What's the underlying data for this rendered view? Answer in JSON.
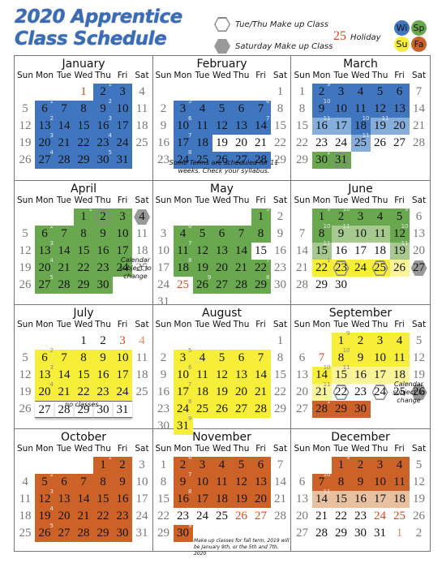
{
  "title": {
    "line1": "2020 Apprentice",
    "line2": "Class Schedule"
  },
  "legend": {
    "tue_thu": "Tue/Thu Make up Class",
    "saturday": "Saturday Make up Class",
    "holiday_num": "25",
    "holiday": "Holiday",
    "terms": [
      {
        "label": "Wi",
        "color": "#3f76bf"
      },
      {
        "label": "Sp",
        "color": "#6aa84f"
      },
      {
        "label": "Su",
        "color": "#f7ee3a"
      },
      {
        "label": "Fa",
        "color": "#cc6228"
      }
    ]
  },
  "dows": [
    "Sun",
    "Mon",
    "Tue",
    "Wed",
    "Thu",
    "Fri",
    "Sat"
  ],
  "colors": {
    "W": "#3f76bf",
    "w": "#86aedb",
    "S": "#6aa84f",
    "s": "#a6c98f",
    "U": "#f7ee3a",
    "u": "#fbf59a",
    "F": "#cc6228",
    "f": "#e8c1a0",
    "holiday": "#d44a1e"
  },
  "months": [
    {
      "name": "January",
      "weeks": [
        [
          "",
          "",
          "",
          "1:r:",
          "2:W:1",
          "3:W:",
          "4:g:"
        ],
        [
          "5:g:",
          "6:W:1",
          "7:W:",
          "8:W:",
          "9:W:2",
          "10:W:",
          "11:g:"
        ],
        [
          "12:g:",
          "13:W:2",
          "14:W:",
          "15:W:",
          "16:W:3",
          "17:W:",
          "18:g:"
        ],
        [
          "19:g:",
          "20:W:3",
          "21:W:",
          "22:W:",
          "23:W:4",
          "24:W:",
          "25:g:"
        ],
        [
          "26:g:",
          "27:W:4",
          "28:W:",
          "29:W:",
          "30:W:5",
          "31:W:",
          ""
        ]
      ]
    },
    {
      "name": "February",
      "note": "Some Terms are scheduled for 11 weeks. Check your syllabus.",
      "weeks": [
        [
          "",
          "",
          "",
          "",
          "",
          "",
          "1:g:"
        ],
        [
          "2:g:",
          "3:W:5",
          "4:W:",
          "5:W:",
          "6:W:",
          "7:W:6",
          "8:g:"
        ],
        [
          "9:g:",
          "10:W:6",
          "11:W:",
          "12:W:",
          "13:W:",
          "14:W:7",
          "15:g:"
        ],
        [
          "16:g:",
          "17:W:7",
          "18:W:",
          "19::",
          "20::",
          "21::",
          "22:g:"
        ],
        [
          "23:g:",
          "24:W:8",
          "25:W:",
          "26:W:",
          "27:W:",
          "28:W:",
          "29:g:"
        ]
      ]
    },
    {
      "name": "March",
      "weeks": [
        [
          "1:g:",
          "2:W:9",
          "3:W:",
          "4:W:",
          "5:W:",
          "6:W:",
          "7:g:"
        ],
        [
          "8:g:",
          "9:W:10",
          "10:W:",
          "11:W:",
          "12:W:",
          "13:W:",
          "14:g:"
        ],
        [
          "15:g:",
          "16:w:11",
          "17:w:",
          "18:W:10",
          "19:w:11",
          "20:w:",
          "21:g:"
        ],
        [
          "22:g:",
          "23::",
          "24::",
          "25:w:11",
          "26::",
          "27::",
          "28:g:"
        ],
        [
          "29:g:",
          "30:S:1",
          "31:Sh:",
          "",
          "",
          "",
          ""
        ]
      ]
    },
    {
      "name": "April",
      "note": "Calendar subject to change",
      "weeks": [
        [
          "",
          "",
          "",
          "1:S:1",
          "2:Sh:",
          "3:S:",
          "4:H:"
        ],
        [
          "5:g:",
          "6:S:2",
          "7:S:",
          "8:S:",
          "9:S:",
          "10:S:",
          "11:g:"
        ],
        [
          "12:g:",
          "13:S:3",
          "14:S:",
          "15:S:",
          "16:S:",
          "17:S:",
          "18:g:"
        ],
        [
          "19:g:",
          "20:S:4",
          "21:S:",
          "22:S:",
          "23:S:",
          "24:S:",
          "25:g:"
        ],
        [
          "26:g:",
          "27:S:5",
          "28:S:",
          "29:S:",
          "30:S:",
          "",
          ""
        ]
      ]
    },
    {
      "name": "May",
      "weeks": [
        [
          "",
          "",
          "",
          "",
          "",
          "1:S:5",
          "2:g:"
        ],
        [
          "3:g:",
          "4:S:6",
          "5:S:",
          "6:S:",
          "7:S:",
          "8:S:",
          "9:g:"
        ],
        [
          "10:g:",
          "11:S:7",
          "12:S:",
          "13:S:",
          "14:S:",
          "15::",
          "16:g:"
        ],
        [
          "17:g:",
          "18:S:8",
          "19:S:",
          "20:S:",
          "21:S:",
          "22:S:7",
          "23:g:"
        ],
        [
          "24:g:",
          "25:r:",
          "26:S:9",
          "27:S:",
          "28:S:",
          "29:S:8",
          "30:g:"
        ],
        [
          "31:g:",
          "",
          "",
          "",
          "",
          "",
          ""
        ]
      ]
    },
    {
      "name": "June",
      "weeks": [
        [
          "",
          "1:S:9",
          "2:S:10",
          "3:S:",
          "4:S:",
          "5:S:9",
          "6:g:"
        ],
        [
          "7:g:",
          "8:S:10",
          "9:s:11",
          "10:s:",
          "11:s:",
          "12:S:10",
          "13:g:"
        ],
        [
          "14:g:",
          "15:s:11",
          "16::",
          "17::",
          "18::",
          "19:s:11",
          "20:g:"
        ],
        [
          "21:g:",
          "22:U:1",
          "23:Uh:",
          "24:U:",
          "25:Uh:",
          "26:u:",
          "27:H:"
        ],
        [
          "28:g:",
          "29::",
          "30::",
          "",
          "",
          "",
          ""
        ]
      ]
    },
    {
      "name": "July",
      "no_classes": "no classes",
      "weeks": [
        [
          "",
          "",
          "",
          "1::",
          "2::",
          "3:r:",
          "4:rg:"
        ],
        [
          "5:g:",
          "6:U:2",
          "7:U:",
          "8:U:",
          "9:U:",
          "10:U:",
          "11:g:"
        ],
        [
          "12:g:",
          "13:U:3",
          "14:U:",
          "15:U:",
          "16:U:",
          "17:U:",
          "18:g:"
        ],
        [
          "19:g:",
          "20:U:4",
          "21:U:",
          "22:U:",
          "23:U:",
          "24:U:",
          "25:g:"
        ],
        [
          "26:g:",
          "27:n:",
          "28:n:",
          "29:n:",
          "30:n:",
          "31:n:",
          ""
        ]
      ]
    },
    {
      "name": "August",
      "weeks": [
        [
          "",
          "",
          "",
          "",
          "",
          "",
          "1:g:"
        ],
        [
          "2:g:",
          "3:U:5",
          "4:U:",
          "5:U:",
          "6:U:",
          "7:U:",
          "8:g:"
        ],
        [
          "9:g:",
          "10:U:6",
          "11:U:",
          "12:U:",
          "13:U:",
          "14:U:",
          "15:g:"
        ],
        [
          "16:g:",
          "17:U:7",
          "18:U:",
          "19:U:",
          "20:U:",
          "21:U:",
          "22:g:"
        ],
        [
          "23:g:",
          "24:U:8",
          "25:U:",
          "26:U:",
          "27:U:",
          "28:U:",
          "29:g:"
        ],
        [
          "30:g:",
          "31:U:9",
          "",
          "",
          "",
          "",
          ""
        ]
      ]
    },
    {
      "name": "September",
      "note": "Calendar subject to change",
      "weeks": [
        [
          "",
          "",
          "1:U:9",
          "2:U:",
          "3:U:",
          "4:U:",
          "5:g:"
        ],
        [
          "6:g:",
          "7:r:",
          "8:U:10",
          "9:U:",
          "10:U:",
          "11:U:",
          "12:g:"
        ],
        [
          "13:g:",
          "14:U:10",
          "15:u:11",
          "16:u:",
          "17:u:",
          "18:u:",
          "19:g:"
        ],
        [
          "20:g:",
          "21:u:11",
          "22:h:",
          "23::",
          "24:h:",
          "25::",
          "26:H:"
        ],
        [
          "27:g:",
          "28:F:1",
          "29:F:",
          "30:F:",
          "",
          "",
          ""
        ]
      ]
    },
    {
      "name": "October",
      "weeks": [
        [
          "",
          "",
          "",
          "",
          "1:F:1",
          "2:F:",
          "3:g:"
        ],
        [
          "4:g:",
          "5:F:2",
          "6:F:",
          "7:F:",
          "8:F:",
          "9:F:",
          "10:g:"
        ],
        [
          "11:g:",
          "12:F:3",
          "13:F:",
          "14:F:",
          "15:F:",
          "16:F:",
          "17:g:"
        ],
        [
          "18:g:",
          "19:F:4",
          "20:F:",
          "21:F:",
          "22:F:",
          "23:F:",
          "24:g:"
        ],
        [
          "25:g:",
          "26:F:5",
          "27:F:",
          "28:F:",
          "29:F:",
          "30:F:",
          "31:g:"
        ]
      ]
    },
    {
      "name": "November",
      "note": "Make up classes for fall term, 2019 will be January 9th, or the 5th and 7th, 2020",
      "weeks": [
        [
          "1:g:",
          "2:F:6",
          "3:F:",
          "4:F:",
          "5:F:",
          "6:F:",
          "7:g:"
        ],
        [
          "8:g:",
          "9:F:7",
          "10:F:",
          "11:F:",
          "12:F:",
          "13:F:",
          "14:g:"
        ],
        [
          "15:g:",
          "16:F:8",
          "17:F:",
          "18:F:",
          "19:F:",
          "20:F:",
          "21:g:"
        ],
        [
          "22:g:",
          "23::",
          "24::",
          "25::",
          "26:r:",
          "27:r:",
          "28:g:"
        ],
        [
          "29:g:",
          "30:F:9",
          "",
          "",
          "",
          "",
          ""
        ]
      ]
    },
    {
      "name": "December",
      "weeks": [
        [
          "",
          "",
          "1:F:9",
          "2:F:",
          "3:F:",
          "4:F:",
          "5:g:"
        ],
        [
          "6:g:",
          "7:F:10",
          "8:F:",
          "9:F:",
          "10:F:",
          "11:F:",
          "12:g:"
        ],
        [
          "13:g:",
          "14:f:11",
          "15:f:",
          "16:f:",
          "17:f:",
          "18:f:",
          "19:g:"
        ],
        [
          "20:g:",
          "21::",
          "22::",
          "23::",
          "24:r:",
          "25:r:",
          "26:g:"
        ],
        [
          "27:g:",
          "28::",
          "29::",
          "30::",
          "31::",
          "1:rg:",
          "2:g:"
        ]
      ]
    }
  ]
}
